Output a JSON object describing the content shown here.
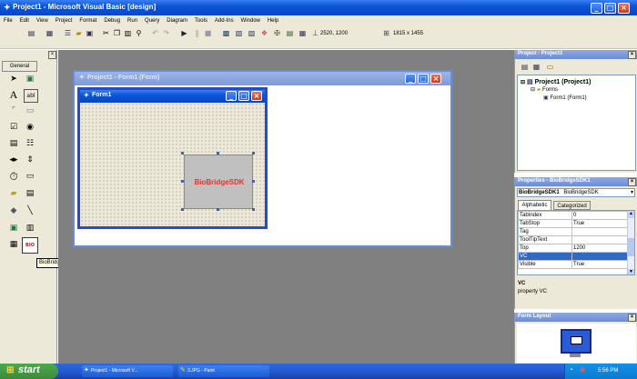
{
  "app": {
    "title": "Project1 - Microsoft Visual Basic [design]"
  },
  "menu": [
    "File",
    "Edit",
    "View",
    "Project",
    "Format",
    "Debug",
    "Run",
    "Query",
    "Diagram",
    "Tools",
    "Add-Ins",
    "Window",
    "Help"
  ],
  "toolbar": {
    "position": "2520, 1200",
    "size": "1815 x 1455"
  },
  "toolbox": {
    "tab": "General",
    "tooltip": "BioBridgeSDK"
  },
  "project_window": {
    "title": "Project1 - Form1 (Form)"
  },
  "form": {
    "title": "Form1",
    "control_label": "BioBridgeSDK"
  },
  "project_explorer": {
    "title": "Project - Project1",
    "root": "Project1 (Project1)",
    "folder": "Forms",
    "item": "Form1 (Form1)"
  },
  "properties": {
    "title": "Properties - BioBridgeSDK1",
    "object": "BioBridgeSDK1",
    "object_type": "BioBridgeSDK",
    "tabs": [
      "Alphabetic",
      "Categorized"
    ],
    "rows": [
      {
        "name": "TabIndex",
        "value": "0"
      },
      {
        "name": "TabStop",
        "value": "True"
      },
      {
        "name": "Tag",
        "value": ""
      },
      {
        "name": "ToolTipText",
        "value": ""
      },
      {
        "name": "Top",
        "value": "1200"
      },
      {
        "name": "VC",
        "value": ""
      },
      {
        "name": "Visible",
        "value": "True"
      }
    ],
    "desc_title": "VC",
    "desc_text": "property VC"
  },
  "form_layout": {
    "title": "Form Layout"
  },
  "taskbar": {
    "start": "start",
    "items": [
      "Project1 - Microsoft V...",
      "3.JPG - Paint"
    ],
    "clock": "5:56 PM"
  },
  "colors": {
    "xp_blue": "#0a55d8",
    "control_text": "#e8332b",
    "taskbar": "#245edb",
    "start_green": "#3c8a3c"
  }
}
